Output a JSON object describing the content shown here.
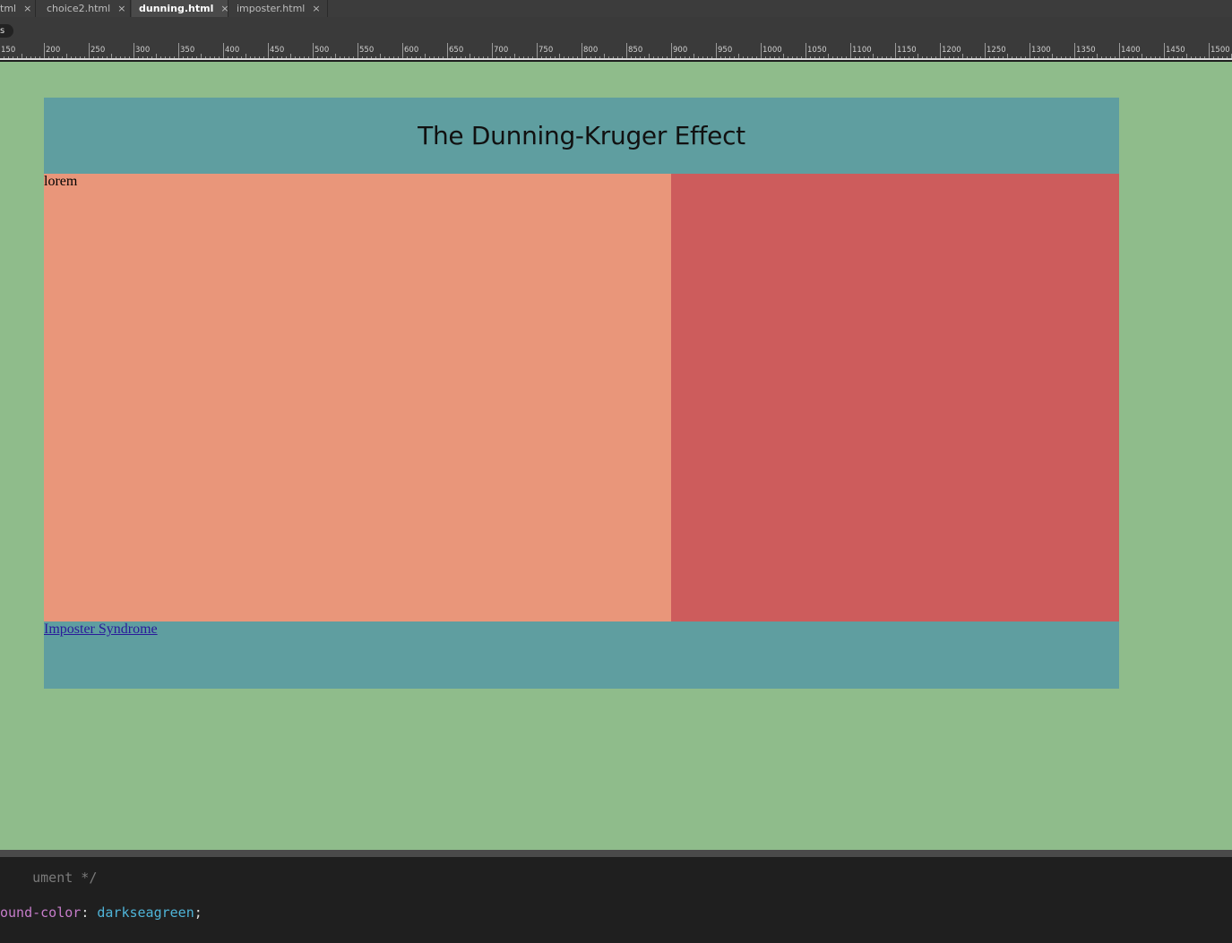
{
  "tabs": [
    {
      "label": "tml",
      "active": false
    },
    {
      "label": "choice2.html",
      "active": false
    },
    {
      "label": "dunning.html",
      "active": true
    },
    {
      "label": "imposter.html",
      "active": false
    }
  ],
  "tab_close_glyph": "×",
  "toolbar": {
    "pill_label": "s"
  },
  "ruler": {
    "labels": [
      "150",
      "200",
      "250",
      "300",
      "350",
      "400",
      "450",
      "500",
      "550",
      "600",
      "650",
      "700",
      "750",
      "800",
      "850",
      "900",
      "950",
      "1000",
      "1050",
      "1100",
      "1150",
      "1200",
      "1250",
      "1300",
      "1350",
      "1400",
      "1450",
      "1500"
    ]
  },
  "page": {
    "title": "The Dunning-Kruger Effect",
    "main_text": "lorem",
    "footer_link": "Imposter Syndrome"
  },
  "colors": {
    "body_bg": "#8fbc8b",
    "header_bg": "#5f9ea0",
    "left_col_bg": "#e9967a",
    "right_col_bg": "#cd5c5c",
    "footer_bg": "#5f9ea0"
  },
  "editor": {
    "comment": "ument */",
    "property": "ound-color",
    "colon": ": ",
    "value": "darkseagreen",
    "semicolon": ";"
  }
}
